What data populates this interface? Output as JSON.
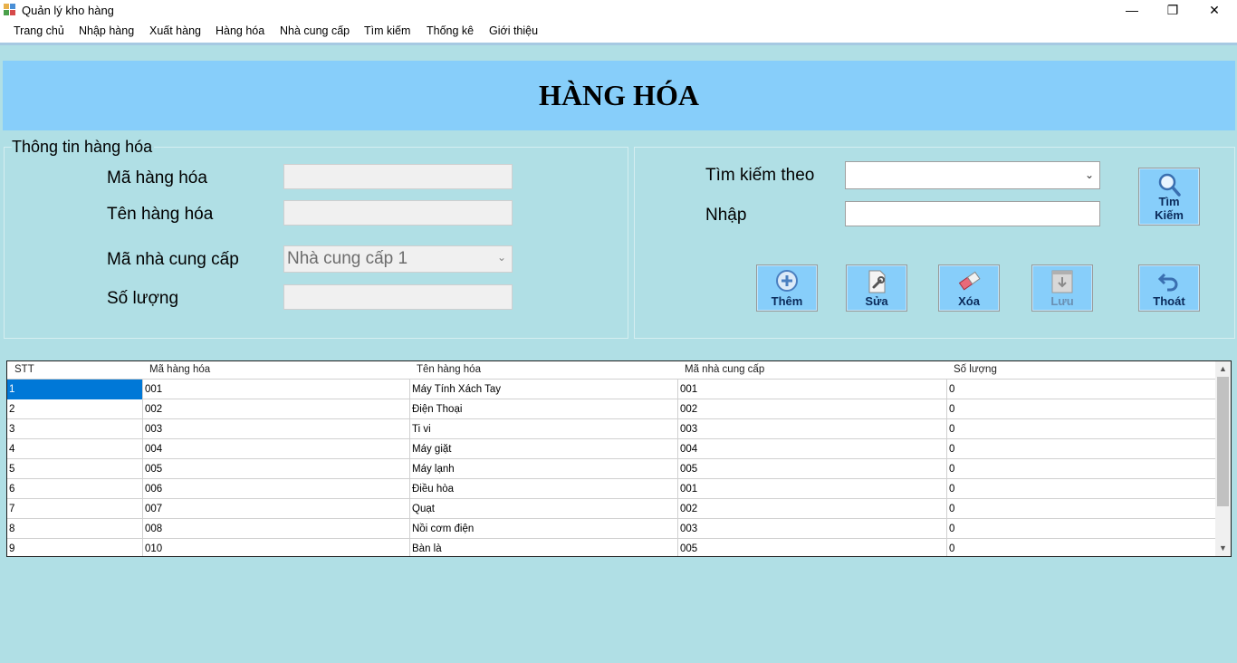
{
  "window": {
    "title": "Quản lý kho hàng",
    "minimize": "—",
    "maximize": "❐",
    "close": "✕"
  },
  "menu": [
    "Trang chủ",
    "Nhập hàng",
    "Xuất hàng",
    "Hàng hóa",
    "Nhà cung cấp",
    "Tìm kiếm",
    "Thống kê",
    "Giới thiệu"
  ],
  "page_title": "HÀNG HÓA",
  "info_group": {
    "caption": "Thông tin hàng hóa",
    "ma_hang_hoa_label": "Mã hàng hóa",
    "ma_hang_hoa_value": "",
    "ten_hang_hoa_label": "Tên hàng hóa",
    "ten_hang_hoa_value": "",
    "ma_ncc_label": "Mã nhà cung cấp",
    "ma_ncc_value": "Nhà cung cấp 1",
    "so_luong_label": "Số lượng",
    "so_luong_value": ""
  },
  "search_group": {
    "search_by_label": "Tìm kiếm theo",
    "search_by_value": "",
    "input_label": "Nhập",
    "input_value": "",
    "search_button_line1": "Tìm",
    "search_button_line2": "Kiếm"
  },
  "buttons": {
    "add": "Thêm",
    "edit": "Sửa",
    "delete": "Xóa",
    "save": "Lưu",
    "exit": "Thoát"
  },
  "grid": {
    "columns": [
      "STT",
      "Mã hàng hóa",
      "Tên hàng hóa",
      "Mã nhà cung cấp",
      "Số lượng"
    ],
    "rows": [
      [
        "1",
        "001",
        "Máy Tính Xách Tay",
        "001",
        "0"
      ],
      [
        "2",
        "002",
        "Điện Thoại",
        "002",
        "0"
      ],
      [
        "3",
        "003",
        "Ti vi",
        "003",
        "0"
      ],
      [
        "4",
        "004",
        "Máy giặt",
        "004",
        "0"
      ],
      [
        "5",
        "005",
        "Máy lạnh",
        "005",
        "0"
      ],
      [
        "6",
        "006",
        "Điều hòa",
        "001",
        "0"
      ],
      [
        "7",
        "007",
        "Quạt",
        "002",
        "0"
      ],
      [
        "8",
        "008",
        "Nồi cơm điện",
        "003",
        "0"
      ],
      [
        "9",
        "010",
        "Bàn là",
        "005",
        "0"
      ]
    ]
  },
  "colors": {
    "background": "#b0dfe5",
    "header_band": "#87cefa",
    "button_face": "#87cefa",
    "selection": "#0078d7"
  }
}
